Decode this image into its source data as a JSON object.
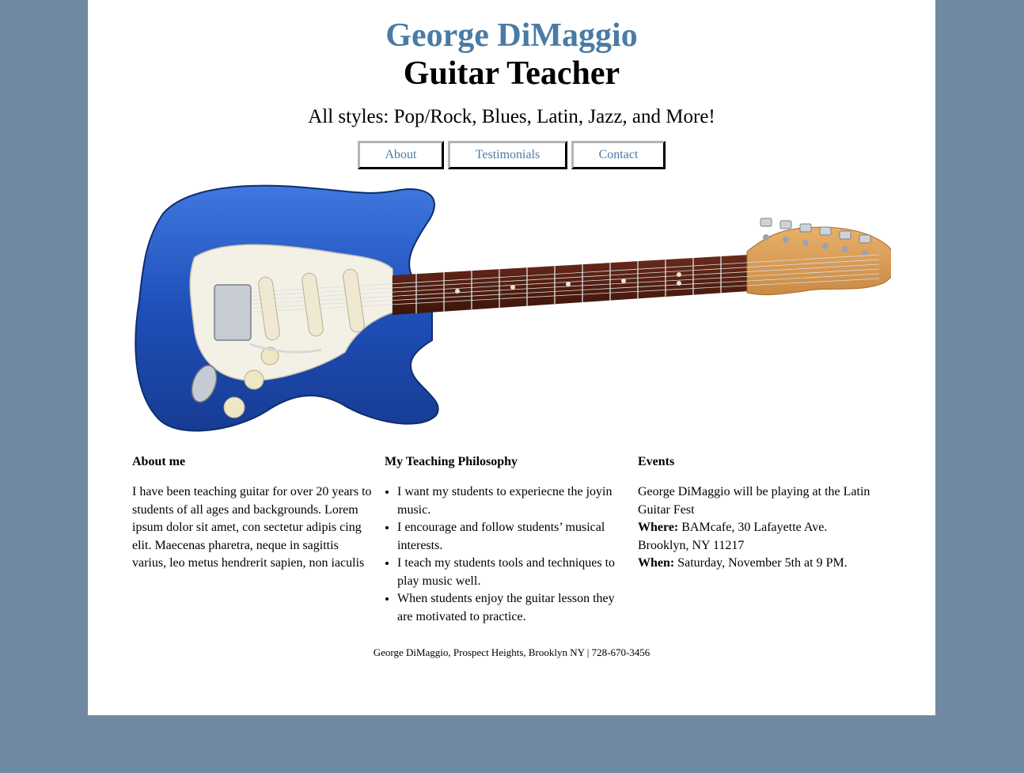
{
  "header": {
    "name": "George DiMaggio",
    "role": "Guitar Teacher",
    "tagline": "All styles: Pop/Rock, Blues, Latin, Jazz, and More!"
  },
  "nav": {
    "items": [
      {
        "label": "About"
      },
      {
        "label": "Testimonials"
      },
      {
        "label": "Contact"
      }
    ]
  },
  "hero": {
    "image": "blue-electric-guitar"
  },
  "about": {
    "heading": "About me",
    "text": "I have been teaching guitar for over 20 years to students of all ages and backgrounds. Lorem ipsum dolor sit amet, con sectetur adipis cing elit. Maecenas pharetra, neque in sagittis varius, leo metus hendrerit sapien, non iaculis"
  },
  "philosophy": {
    "heading": "My Teaching Philosophy",
    "items": [
      "I want my students to experiecne the joyin music.",
      "I encourage and follow students’ musical interests.",
      "I teach my students tools and techniques to play music well.",
      "When students enjoy the guitar lesson they are motivated to practice."
    ]
  },
  "events": {
    "heading": "Events",
    "intro": "George DiMaggio will be playing at the Latin Guitar Fest",
    "where_label": "Where:",
    "where_line1": "BAMcafe, 30 Lafayette Ave.",
    "where_line2": "Brooklyn, NY 11217",
    "when_label": "When:",
    "when_value": "Saturday, November 5th at 9 PM."
  },
  "footer": {
    "text": "George DiMaggio, Prospect Heights, Brooklyn NY | 728-670-3456"
  },
  "colors": {
    "page_background": "#6f89a3",
    "content_background": "#ffffff",
    "accent_blue": "#4a7ba6",
    "guitar_body": "#1f4fb8"
  }
}
